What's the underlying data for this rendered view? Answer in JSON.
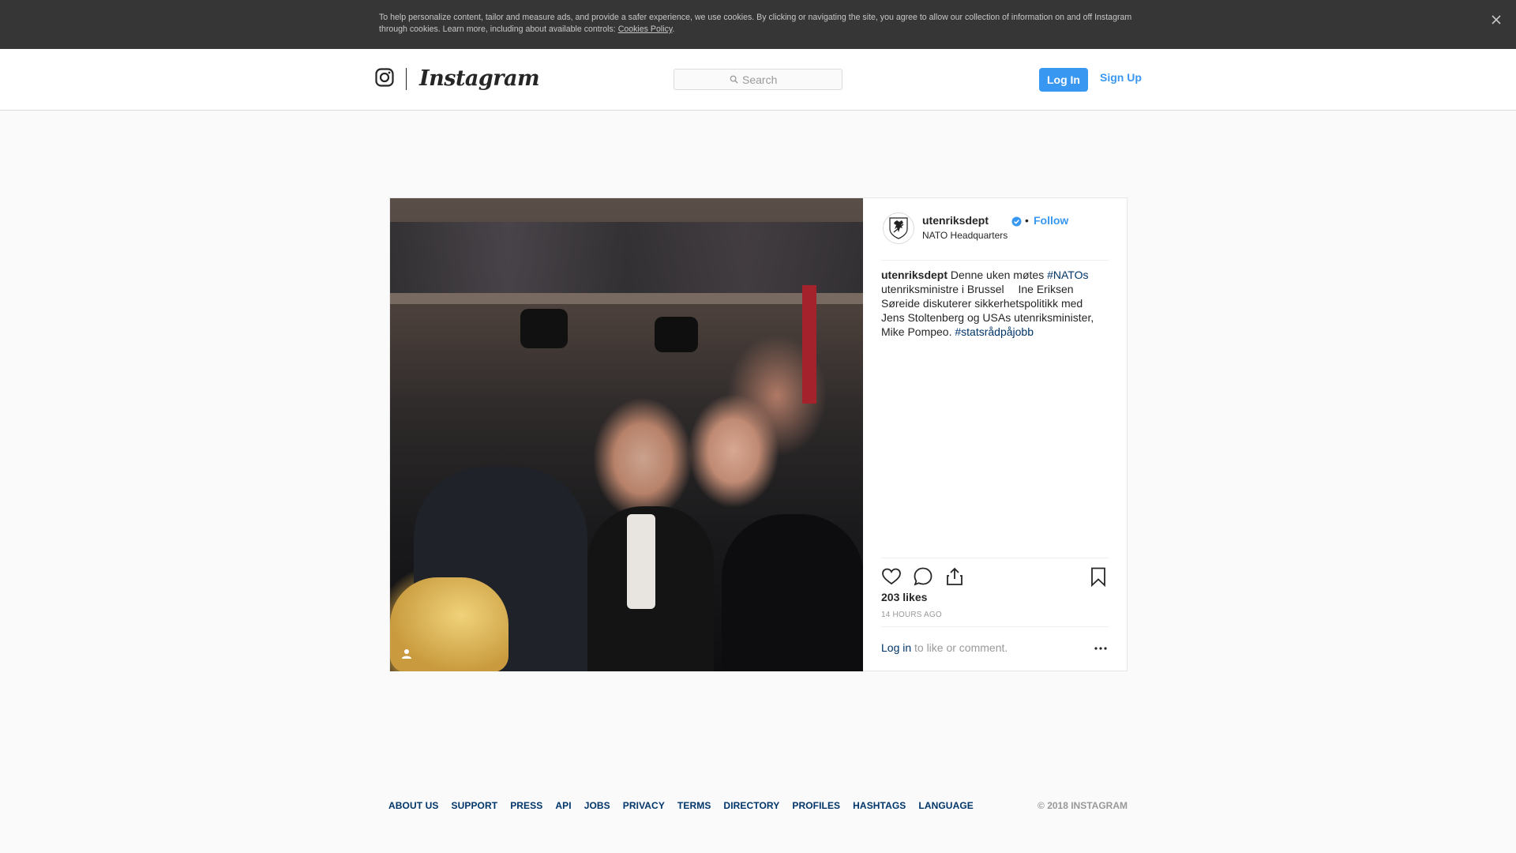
{
  "cookie_banner": {
    "text": "To help personalize content, tailor and measure ads, and provide a safer experience, we use cookies. By clicking or navigating the site, you agree to allow our collection of information on and off Instagram through cookies. Learn more, including about available controls: ",
    "link_label": "Cookies Policy",
    "suffix": ".",
    "close_icon": "close-icon"
  },
  "header": {
    "brand": "Instagram",
    "search_placeholder": "Search",
    "login_label": "Log In",
    "signup_label": "Sign Up"
  },
  "post": {
    "username": "utenriksdept",
    "verified": true,
    "separator": "•",
    "follow_label": "Follow",
    "location": "NATO Headquarters",
    "caption": {
      "user": "utenriksdept",
      "text_1": " Denne uken møtes ",
      "tag_1": "#NATOs",
      "text_2": " utenriksministre i Brussel  Ine Eriksen Søreide diskuterer sikkerhetspolitikk med Jens Stoltenberg og USAs utenriksminister, Mike Pompeo. ",
      "tag_2": "#statsrådpåjobb"
    },
    "likes": "203 likes",
    "time": "14 HOURS AGO",
    "login_link": "Log in",
    "comment_hint": "to like or comment."
  },
  "footer": {
    "links": [
      "ABOUT US",
      "SUPPORT",
      "PRESS",
      "API",
      "JOBS",
      "PRIVACY",
      "TERMS",
      "DIRECTORY",
      "PROFILES",
      "HASHTAGS",
      "LANGUAGE"
    ],
    "copyright": "© 2018 INSTAGRAM"
  },
  "colors": {
    "accent": "#3897f0",
    "link_dark": "#003569",
    "banner_bg": "#363636",
    "page_bg": "#fafafa"
  }
}
